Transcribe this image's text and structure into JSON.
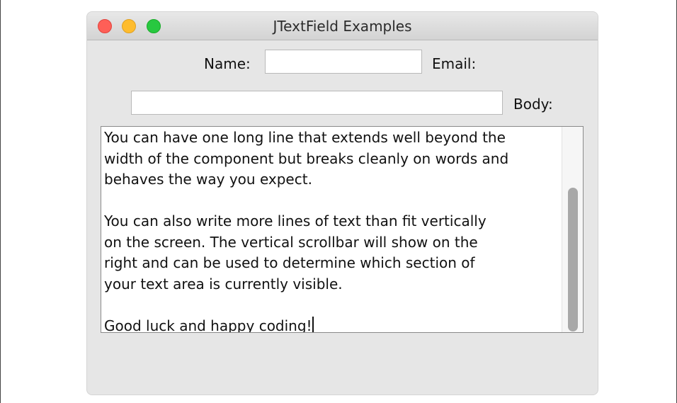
{
  "window": {
    "title": "JTextField Examples"
  },
  "form": {
    "name_label": "Name:",
    "name_value": "",
    "email_label": "Email:",
    "email_value": "",
    "body_label": "Body:"
  },
  "textarea": {
    "lines": [
      "You can have one long line that extends well beyond the",
      "width of the component but breaks cleanly on words and",
      "behaves the way you expect.",
      "",
      "You can also write more lines of text than fit vertically",
      "on the screen. The vertical scrollbar will show on the",
      "right and can be used to determine which section of",
      "your text area is currently visible.",
      "",
      "Good luck and happy coding!"
    ]
  },
  "colors": {
    "close": "#fe5f57",
    "minimize": "#febc2e",
    "maximize": "#28c840"
  },
  "icons": {
    "close": "close-circle-icon",
    "minimize": "minimize-circle-icon",
    "maximize": "maximize-circle-icon"
  }
}
